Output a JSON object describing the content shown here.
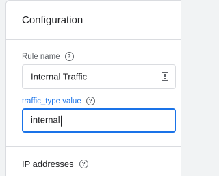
{
  "panel": {
    "title": "Configuration"
  },
  "rule_name": {
    "label": "Rule name",
    "value": "Internal Traffic",
    "help_icon": "help-circle-icon",
    "trailing_icon": "variable-picker-icon"
  },
  "traffic_type": {
    "label": "traffic_type value",
    "value": "internal",
    "help_icon": "help-circle-icon"
  },
  "ip_addresses": {
    "title": "IP addresses",
    "help_icon": "help-circle-icon"
  },
  "colors": {
    "accent": "#1a73e8",
    "border": "#dadce0",
    "text": "#202124",
    "muted": "#5f6368"
  }
}
